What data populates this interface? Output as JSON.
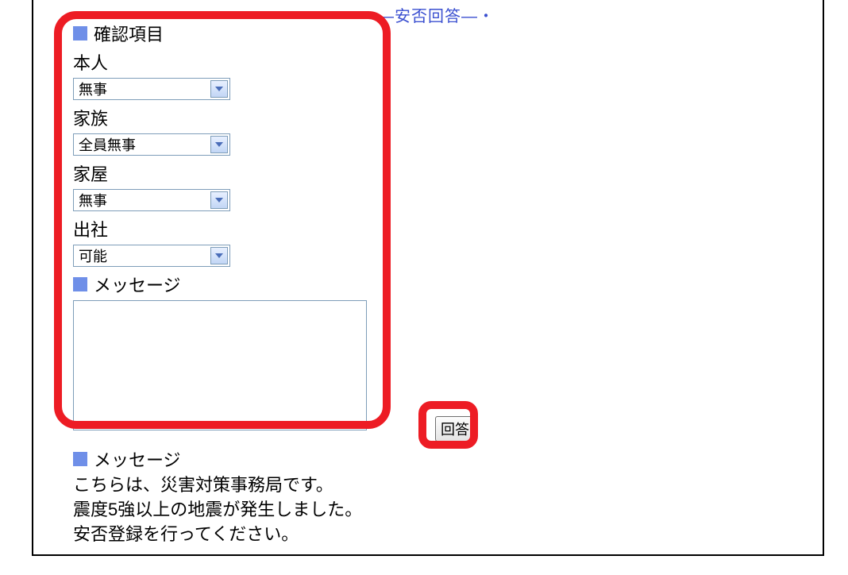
{
  "page": {
    "title_decorated": "・―安否回答―・"
  },
  "form": {
    "section_header": "確認項目",
    "fields": {
      "self": {
        "label": "本人",
        "value": "無事"
      },
      "family": {
        "label": "家族",
        "value": "全員無事"
      },
      "house": {
        "label": "家屋",
        "value": "無事"
      },
      "attendance": {
        "label": "出社",
        "value": "可能"
      }
    },
    "message_section": "メッセージ",
    "message_value": ""
  },
  "actions": {
    "submit_label": "回答"
  },
  "info": {
    "header": "メッセージ",
    "line1": "こちらは、災害対策事務局です。",
    "line2": "震度5強以上の地震が発生しました。",
    "line3": "安否登録を行ってください。"
  }
}
